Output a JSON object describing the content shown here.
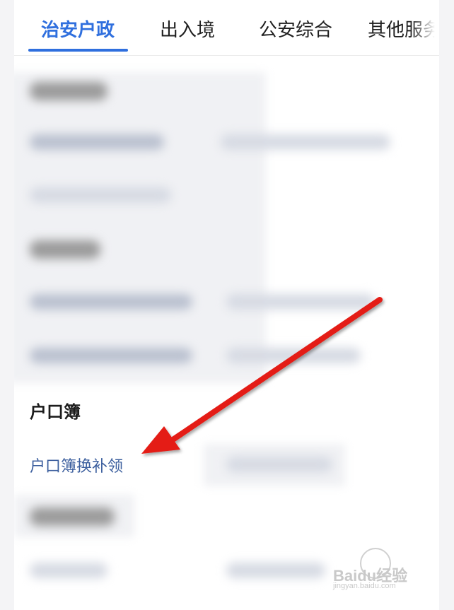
{
  "tabs": [
    {
      "label": "治安户政",
      "active": true
    },
    {
      "label": "出入境",
      "active": false
    },
    {
      "label": "公安综合",
      "active": false
    },
    {
      "label": "其他服务",
      "active": false
    }
  ],
  "section": {
    "title": "户口簿",
    "items": [
      {
        "label": "户口簿换补领"
      }
    ]
  },
  "colors": {
    "accent": "#2f6fde",
    "link": "#3c5f9e",
    "arrow": "#e41b13"
  },
  "watermark": {
    "brand": "Baidu经验",
    "url": "jingyan.baidu.com"
  }
}
